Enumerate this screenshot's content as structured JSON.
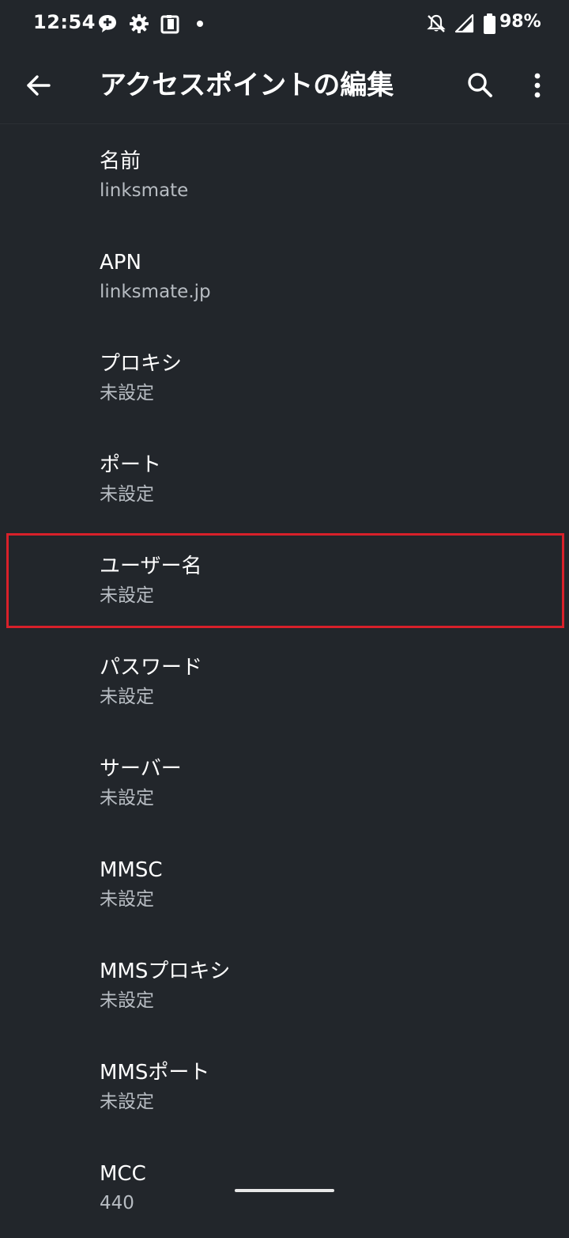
{
  "status_bar": {
    "time": "12:54",
    "battery_percent": "98%",
    "icons": [
      "chat-bubble-icon",
      "gear-icon",
      "clipboard-icon",
      "notification-dot-icon",
      "bell-off-icon",
      "signal-icon",
      "battery-icon"
    ]
  },
  "app_bar": {
    "title": "アクセスポイントの編集",
    "icons": [
      "back-arrow-icon",
      "search-icon",
      "more-vert-icon"
    ]
  },
  "settings": [
    {
      "title": "名前",
      "value": "linksmate"
    },
    {
      "title": "APN",
      "value": "linksmate.jp"
    },
    {
      "title": "プロキシ",
      "value": "未設定"
    },
    {
      "title": "ポート",
      "value": "未設定"
    },
    {
      "title": "ユーザー名",
      "value": "未設定"
    },
    {
      "title": "パスワード",
      "value": "未設定"
    },
    {
      "title": "サーバー",
      "value": "未設定"
    },
    {
      "title": "MMSC",
      "value": "未設定"
    },
    {
      "title": "MMSプロキシ",
      "value": "未設定"
    },
    {
      "title": "MMSポート",
      "value": "未設定"
    },
    {
      "title": "MCC",
      "value": "440"
    }
  ],
  "colors": {
    "background": "#22262b",
    "highlight": "#d8202a",
    "secondary_text": "#b7bcc2"
  }
}
